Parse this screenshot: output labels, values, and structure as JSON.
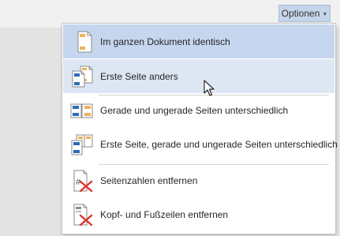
{
  "options_button": {
    "label": "Optionen",
    "caret_icon": "chevron-down-icon"
  },
  "menu": {
    "items": [
      {
        "id": "same-document",
        "label": "Im ganzen Dokument identisch",
        "icon": "single-page-icon",
        "state": "selected"
      },
      {
        "id": "different-first",
        "label": "Erste Seite anders",
        "icon": "different-first-page-icon",
        "state": "hover"
      },
      {
        "id": "different-odd-even",
        "label": "Gerade und ungerade Seiten unterschiedlich",
        "icon": "odd-even-pages-icon",
        "state": "normal"
      },
      {
        "id": "different-first-odd-even",
        "label": "Erste Seite, gerade und ungerade Seiten unterschiedlich",
        "icon": "first-odd-even-pages-icon",
        "state": "normal"
      },
      {
        "id": "remove-page-numbers",
        "label": "Seitenzahlen entfernen",
        "icon": "remove-page-number-icon",
        "state": "normal"
      },
      {
        "id": "remove-header-footer",
        "label": "Kopf- und Fußzeilen entfernen",
        "icon": "remove-header-footer-icon",
        "state": "normal"
      }
    ]
  },
  "colors": {
    "selected": "#c5d6ee",
    "hover": "#dde7f4",
    "accent_blue": "#2e6cb5",
    "accent_orange": "#f0b15a",
    "remove_red": "#d9362b"
  }
}
